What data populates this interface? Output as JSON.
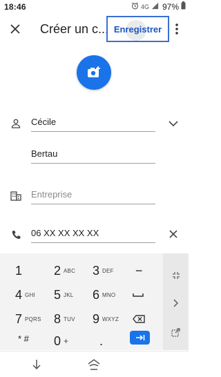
{
  "status_bar": {
    "time": "18:46",
    "network": "4G",
    "battery": "97%"
  },
  "app_bar": {
    "title": "Créer un c...",
    "save_label": "Enregistrer"
  },
  "form": {
    "first_name": "Cécile",
    "last_name": "Bertau",
    "company_placeholder": "Entreprise",
    "phone": "06 XX XX XX XX"
  },
  "keyboard": {
    "keys": [
      {
        "num": "1",
        "sub": ""
      },
      {
        "num": "2",
        "sub": "ABC"
      },
      {
        "num": "3",
        "sub": "DEF"
      },
      {
        "num": "−",
        "sub": ""
      },
      {
        "num": "4",
        "sub": "GHI"
      },
      {
        "num": "5",
        "sub": "JKL"
      },
      {
        "num": "6",
        "sub": "MNO"
      },
      {
        "num": "7",
        "sub": "PQRS"
      },
      {
        "num": "8",
        "sub": "TUV"
      },
      {
        "num": "9",
        "sub": "WXYZ"
      },
      {
        "num": "* #",
        "sub": ""
      },
      {
        "num": "0",
        "sub": "+"
      },
      {
        "num": ".",
        "sub": ""
      }
    ]
  },
  "colors": {
    "accent": "#1a73e8",
    "save_border": "#3a6fd2"
  }
}
